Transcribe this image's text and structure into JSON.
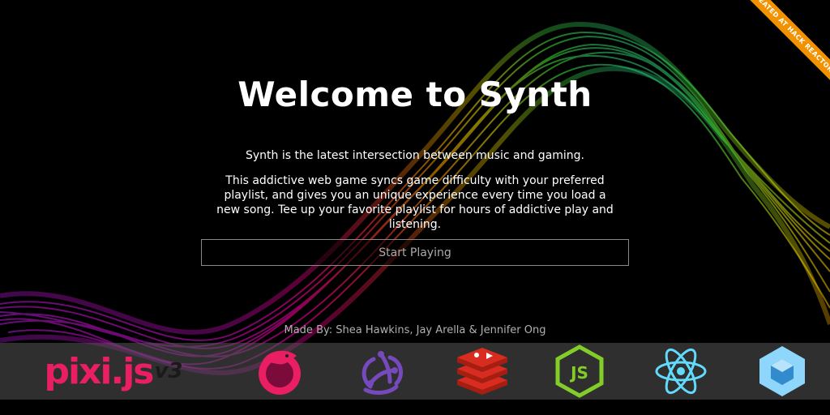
{
  "banner": {
    "text": "CREATED AT HACK REACTOR"
  },
  "hero": {
    "title": "Welcome to Synth",
    "tagline": "Synth is the latest intersection between music and gaming.",
    "description": "This addictive web game syncs game difficulty with your preferred playlist, and gives you an unique experience every time you load a new song. Tee up your favorite playlist for hours of addictive play and listening."
  },
  "cta": {
    "start_label": "Start Playing"
  },
  "credits": {
    "made_by": "Made By: Shea Hawkins, Jay Arella & Jennifer Ong"
  },
  "logos": {
    "pixi_name": "pixi.js",
    "pixi_version": "v3",
    "items": [
      "pixi-js-logo",
      "rxjs-logo",
      "redux-logo",
      "redis-logo",
      "nodejs-logo",
      "react-logo",
      "webpack-logo"
    ]
  },
  "colors": {
    "background": "#000000",
    "banner": "#f39200",
    "pixi": "#e91e63",
    "rxjs": "#e91e63",
    "redux": "#764abc",
    "redis": "#d82c20",
    "node": "#83cd29",
    "react": "#61dafb",
    "webpack": "#8ed6fb"
  }
}
